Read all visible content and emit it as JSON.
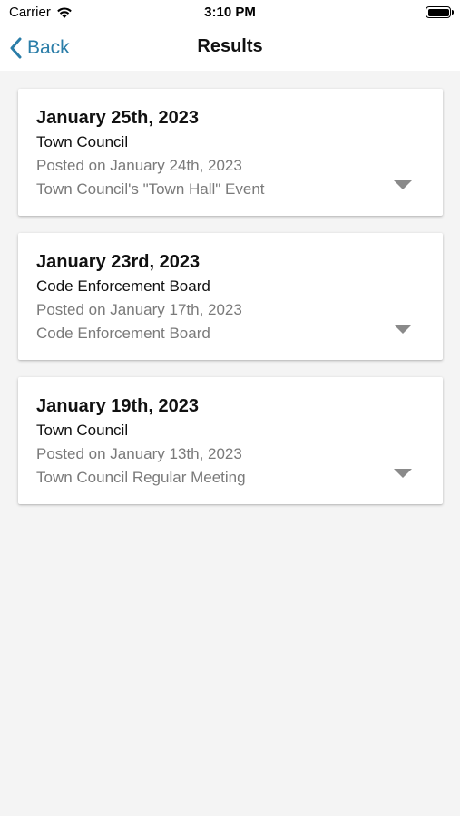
{
  "status_bar": {
    "carrier": "Carrier",
    "time": "3:10 PM",
    "icons": [
      "wifi-icon",
      "battery-icon"
    ]
  },
  "nav": {
    "back_label": "Back",
    "title": "Results",
    "accent_color": "#2a7da8"
  },
  "results": [
    {
      "date": "January 25th, 2023",
      "body": "Town Council",
      "posted": "Posted on January 24th, 2023",
      "description": "Town Council's \"Town Hall\" Event"
    },
    {
      "date": "January 23rd, 2023",
      "body": "Code Enforcement Board",
      "posted": "Posted on January 17th, 2023",
      "description": "Code Enforcement Board"
    },
    {
      "date": "January 19th, 2023",
      "body": "Town Council",
      "posted": "Posted on January 13th, 2023",
      "description": "Town Council Regular Meeting"
    }
  ]
}
